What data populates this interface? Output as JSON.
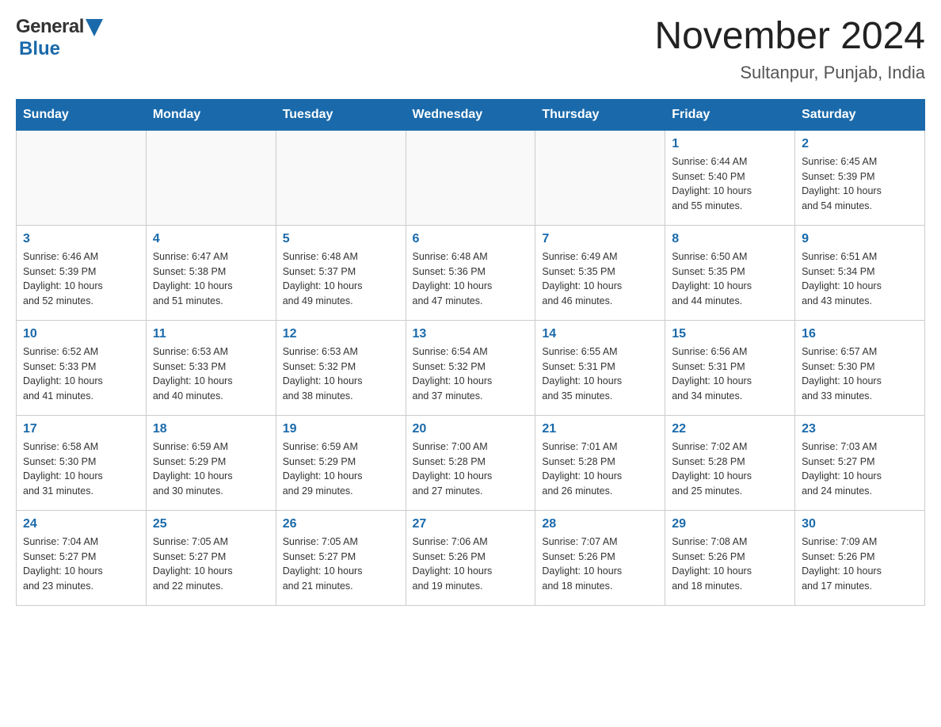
{
  "header": {
    "logo_general": "General",
    "logo_blue": "Blue",
    "month_title": "November 2024",
    "location": "Sultanpur, Punjab, India"
  },
  "days_of_week": [
    "Sunday",
    "Monday",
    "Tuesday",
    "Wednesday",
    "Thursday",
    "Friday",
    "Saturday"
  ],
  "weeks": [
    [
      {
        "day": "",
        "info": ""
      },
      {
        "day": "",
        "info": ""
      },
      {
        "day": "",
        "info": ""
      },
      {
        "day": "",
        "info": ""
      },
      {
        "day": "",
        "info": ""
      },
      {
        "day": "1",
        "info": "Sunrise: 6:44 AM\nSunset: 5:40 PM\nDaylight: 10 hours\nand 55 minutes."
      },
      {
        "day": "2",
        "info": "Sunrise: 6:45 AM\nSunset: 5:39 PM\nDaylight: 10 hours\nand 54 minutes."
      }
    ],
    [
      {
        "day": "3",
        "info": "Sunrise: 6:46 AM\nSunset: 5:39 PM\nDaylight: 10 hours\nand 52 minutes."
      },
      {
        "day": "4",
        "info": "Sunrise: 6:47 AM\nSunset: 5:38 PM\nDaylight: 10 hours\nand 51 minutes."
      },
      {
        "day": "5",
        "info": "Sunrise: 6:48 AM\nSunset: 5:37 PM\nDaylight: 10 hours\nand 49 minutes."
      },
      {
        "day": "6",
        "info": "Sunrise: 6:48 AM\nSunset: 5:36 PM\nDaylight: 10 hours\nand 47 minutes."
      },
      {
        "day": "7",
        "info": "Sunrise: 6:49 AM\nSunset: 5:35 PM\nDaylight: 10 hours\nand 46 minutes."
      },
      {
        "day": "8",
        "info": "Sunrise: 6:50 AM\nSunset: 5:35 PM\nDaylight: 10 hours\nand 44 minutes."
      },
      {
        "day": "9",
        "info": "Sunrise: 6:51 AM\nSunset: 5:34 PM\nDaylight: 10 hours\nand 43 minutes."
      }
    ],
    [
      {
        "day": "10",
        "info": "Sunrise: 6:52 AM\nSunset: 5:33 PM\nDaylight: 10 hours\nand 41 minutes."
      },
      {
        "day": "11",
        "info": "Sunrise: 6:53 AM\nSunset: 5:33 PM\nDaylight: 10 hours\nand 40 minutes."
      },
      {
        "day": "12",
        "info": "Sunrise: 6:53 AM\nSunset: 5:32 PM\nDaylight: 10 hours\nand 38 minutes."
      },
      {
        "day": "13",
        "info": "Sunrise: 6:54 AM\nSunset: 5:32 PM\nDaylight: 10 hours\nand 37 minutes."
      },
      {
        "day": "14",
        "info": "Sunrise: 6:55 AM\nSunset: 5:31 PM\nDaylight: 10 hours\nand 35 minutes."
      },
      {
        "day": "15",
        "info": "Sunrise: 6:56 AM\nSunset: 5:31 PM\nDaylight: 10 hours\nand 34 minutes."
      },
      {
        "day": "16",
        "info": "Sunrise: 6:57 AM\nSunset: 5:30 PM\nDaylight: 10 hours\nand 33 minutes."
      }
    ],
    [
      {
        "day": "17",
        "info": "Sunrise: 6:58 AM\nSunset: 5:30 PM\nDaylight: 10 hours\nand 31 minutes."
      },
      {
        "day": "18",
        "info": "Sunrise: 6:59 AM\nSunset: 5:29 PM\nDaylight: 10 hours\nand 30 minutes."
      },
      {
        "day": "19",
        "info": "Sunrise: 6:59 AM\nSunset: 5:29 PM\nDaylight: 10 hours\nand 29 minutes."
      },
      {
        "day": "20",
        "info": "Sunrise: 7:00 AM\nSunset: 5:28 PM\nDaylight: 10 hours\nand 27 minutes."
      },
      {
        "day": "21",
        "info": "Sunrise: 7:01 AM\nSunset: 5:28 PM\nDaylight: 10 hours\nand 26 minutes."
      },
      {
        "day": "22",
        "info": "Sunrise: 7:02 AM\nSunset: 5:28 PM\nDaylight: 10 hours\nand 25 minutes."
      },
      {
        "day": "23",
        "info": "Sunrise: 7:03 AM\nSunset: 5:27 PM\nDaylight: 10 hours\nand 24 minutes."
      }
    ],
    [
      {
        "day": "24",
        "info": "Sunrise: 7:04 AM\nSunset: 5:27 PM\nDaylight: 10 hours\nand 23 minutes."
      },
      {
        "day": "25",
        "info": "Sunrise: 7:05 AM\nSunset: 5:27 PM\nDaylight: 10 hours\nand 22 minutes."
      },
      {
        "day": "26",
        "info": "Sunrise: 7:05 AM\nSunset: 5:27 PM\nDaylight: 10 hours\nand 21 minutes."
      },
      {
        "day": "27",
        "info": "Sunrise: 7:06 AM\nSunset: 5:26 PM\nDaylight: 10 hours\nand 19 minutes."
      },
      {
        "day": "28",
        "info": "Sunrise: 7:07 AM\nSunset: 5:26 PM\nDaylight: 10 hours\nand 18 minutes."
      },
      {
        "day": "29",
        "info": "Sunrise: 7:08 AM\nSunset: 5:26 PM\nDaylight: 10 hours\nand 18 minutes."
      },
      {
        "day": "30",
        "info": "Sunrise: 7:09 AM\nSunset: 5:26 PM\nDaylight: 10 hours\nand 17 minutes."
      }
    ]
  ]
}
